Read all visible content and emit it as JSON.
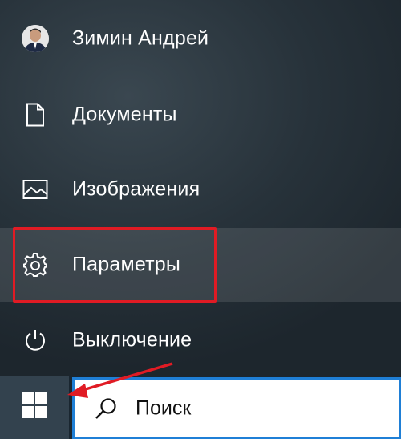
{
  "start_menu": {
    "items": [
      {
        "label": "Зимин Андрей",
        "icon": "user-avatar"
      },
      {
        "label": "Документы",
        "icon": "document-icon"
      },
      {
        "label": "Изображения",
        "icon": "pictures-icon"
      },
      {
        "label": "Параметры",
        "icon": "gear-icon"
      },
      {
        "label": "Выключение",
        "icon": "power-icon"
      }
    ],
    "highlighted_item": "Параметры"
  },
  "taskbar": {
    "start_icon": "windows-logo-icon",
    "search": {
      "placeholder": "Поиск",
      "icon": "search-icon"
    }
  },
  "annotation": {
    "highlight_color": "#e01b24",
    "arrow_color": "#e01b24"
  }
}
